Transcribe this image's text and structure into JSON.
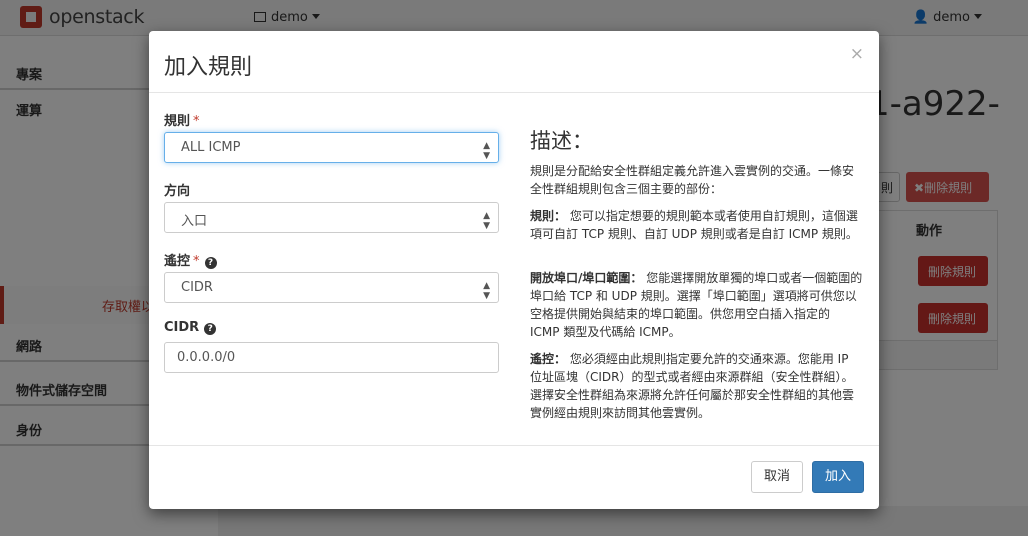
{
  "brand": {
    "name": "openstack"
  },
  "topbar": {
    "project": "demo",
    "user": "demo"
  },
  "sidebar": {
    "items": [
      {
        "label": "專案"
      },
      {
        "label": "運算"
      },
      {
        "label": "存取權以"
      },
      {
        "label": "網路"
      },
      {
        "label": "物件式儲存空間"
      },
      {
        "label": "身份"
      }
    ]
  },
  "content": {
    "title_fragment": "1-a922-",
    "button_a": "則",
    "button_delete_rules": "刪除規則",
    "table_header_actions": "動作",
    "row_delete": "刪除規則"
  },
  "modal": {
    "title": "加入規則",
    "close": "×",
    "fields": {
      "rule": {
        "label": "規則",
        "required": "*",
        "value": "ALL ICMP"
      },
      "direction": {
        "label": "方向",
        "value": "入口"
      },
      "remote": {
        "label": "遙控",
        "required": "*",
        "value": "CIDR"
      },
      "cidr": {
        "label": "CIDR",
        "value": "0.0.0.0/0"
      }
    },
    "description": {
      "title": "描述：",
      "intro": "規則是分配給安全性群組定義允許進入雲實例的交通。一條安全性群組規則包含三個主要的部份：",
      "rule_term": "規則：",
      "rule_text": "您可以指定想要的規則範本或者使用自訂規則，這個選項可自訂 TCP 規則、自訂 UDP 規則或者是自訂 ICMP 規則。",
      "port_term": "開放埠口/埠口範圍：",
      "port_text": "您能選擇開放單獨的埠口或者一個範圍的埠口給 TCP 和 UDP 規則。選擇「埠口範圍」選項將可供您以空格提供開始與結束的埠口範圍。供您用空白插入指定的 ICMP 類型及代碼給 ICMP。",
      "remote_term": "遙控：",
      "remote_text": "您必須經由此規則指定要允許的交通來源。您能用 IP 位址區塊（CIDR）的型式或者經由來源群組（安全性群組）。選擇安全性群組為來源將允許任何屬於那安全性群組的其他雲實例經由規則來訪問其他雲實例。"
    },
    "buttons": {
      "cancel": "取消",
      "submit": "加入"
    }
  },
  "colors": {
    "primary": "#337ab7",
    "danger": "#d9534f",
    "brand": "#c0392b"
  }
}
